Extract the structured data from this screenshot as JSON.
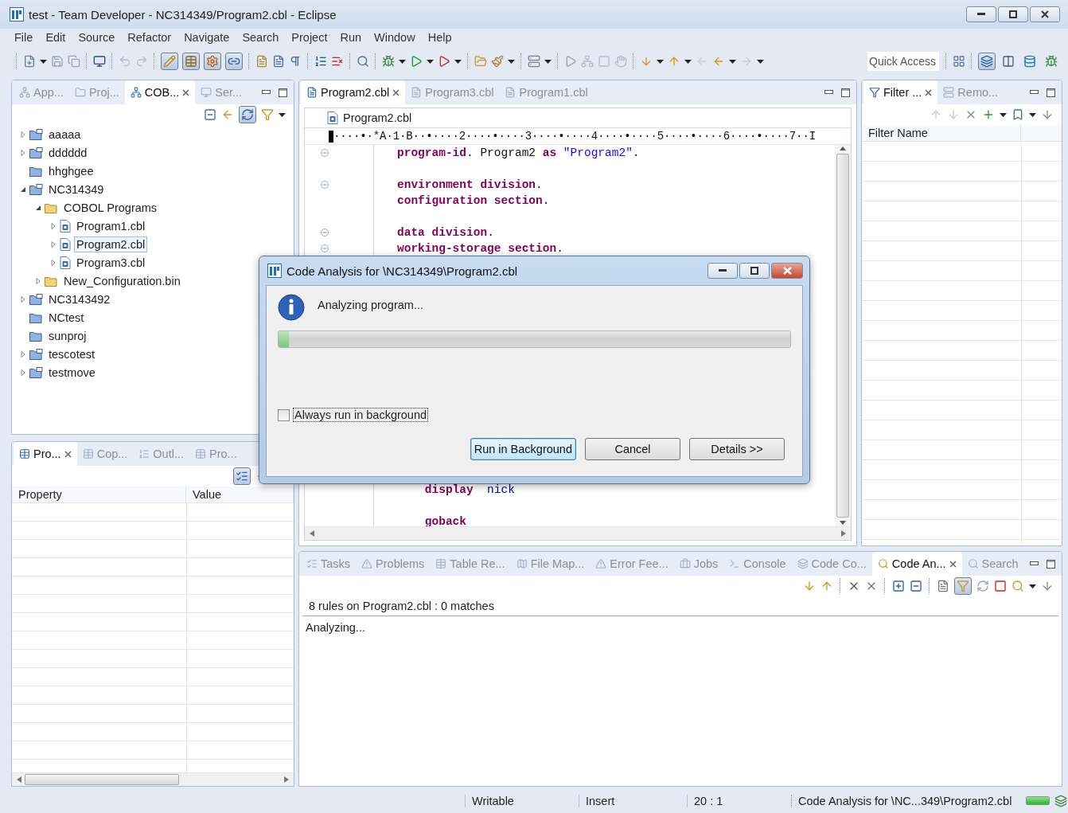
{
  "window": {
    "title": "test - Team Developer - NC314349/Program2.cbl - Eclipse"
  },
  "menu": [
    "File",
    "Edit",
    "Source",
    "Refactor",
    "Navigate",
    "Search",
    "Project",
    "Run",
    "Window",
    "Help"
  ],
  "toolbar": {
    "toggles": [
      {
        "pressed": true
      },
      {
        "pressed": true
      },
      {
        "pressed": true
      },
      {
        "pressed": true
      }
    ],
    "quick_access": {
      "placeholder": "Quick Access"
    },
    "perspectives": [
      {
        "selected": true
      },
      {
        "selected": false
      },
      {
        "selected": false
      },
      {
        "selected": false
      }
    ]
  },
  "explorer": {
    "tabs": [
      {
        "label": "App...",
        "selected": false
      },
      {
        "label": "Proj...",
        "selected": false
      },
      {
        "label": "COB...",
        "selected": true
      },
      {
        "label": "Ser...",
        "selected": false
      }
    ],
    "link_toggle": {
      "pressed": true
    },
    "tree": [
      {
        "label": "aaaaa",
        "kind": "project",
        "expanded": false,
        "selected": false
      },
      {
        "label": "dddddd",
        "kind": "project",
        "expanded": false,
        "selected": false
      },
      {
        "label": "hhghgee",
        "kind": "closed-project",
        "selected": false
      },
      {
        "label": "NC314349",
        "kind": "project",
        "expanded": true,
        "selected": false,
        "children": [
          {
            "label": "COBOL Programs",
            "kind": "folder",
            "expanded": true,
            "selected": false,
            "children": [
              {
                "label": "Program1.cbl",
                "kind": "file",
                "expanded": false,
                "selected": false
              },
              {
                "label": "Program2.cbl",
                "kind": "file",
                "expanded": false,
                "selected": true
              },
              {
                "label": "Program3.cbl",
                "kind": "file",
                "expanded": false,
                "selected": false
              }
            ]
          },
          {
            "label": "New_Configuration.bin",
            "kind": "folder",
            "expanded": false,
            "selected": false
          }
        ]
      },
      {
        "label": "NC3143492",
        "kind": "project",
        "expanded": false,
        "selected": false
      },
      {
        "label": "NCtest",
        "kind": "closed-project",
        "selected": false
      },
      {
        "label": "sunproj",
        "kind": "closed-project",
        "selected": false
      },
      {
        "label": "tescotest",
        "kind": "project",
        "expanded": false,
        "selected": false
      },
      {
        "label": "testmove",
        "kind": "project",
        "expanded": false,
        "selected": false
      }
    ]
  },
  "properties": {
    "tabs": [
      {
        "label": "Pro...",
        "selected": true
      },
      {
        "label": "Cop...",
        "selected": false
      },
      {
        "label": "Outl...",
        "selected": false
      },
      {
        "label": "Pro...",
        "selected": false
      }
    ],
    "categories_toggle": {
      "pressed": true
    },
    "columns": [
      "Property",
      "Value"
    ]
  },
  "editor": {
    "tabs": [
      {
        "label": "Program2.cbl",
        "selected": true
      },
      {
        "label": "Program3.cbl",
        "selected": false
      },
      {
        "label": "Program1.cbl",
        "selected": false
      }
    ],
    "breadcrumb": "Program2.cbl",
    "ruler": "····•·*A·1·B··•····2····•····3····•····4····•····5····•····6····•····7··I",
    "lines_top": [
      {
        "fold": true,
        "tokens": [
          {
            "kind": "keyword",
            "text": "program-id"
          },
          {
            "kind": "plain",
            "text": ". Program2 "
          },
          {
            "kind": "keyword",
            "text": "as"
          },
          {
            "kind": "string",
            "text": " \"Program2\""
          },
          {
            "kind": "plain",
            "text": "."
          }
        ]
      },
      {
        "blank": true
      },
      {
        "fold": true,
        "tokens": [
          {
            "kind": "keyword",
            "text": "environment division"
          },
          {
            "kind": "plain",
            "text": "."
          }
        ]
      },
      {
        "fold": false,
        "tokens": [
          {
            "kind": "keyword",
            "text": "configuration section"
          },
          {
            "kind": "plain",
            "text": "."
          }
        ]
      },
      {
        "blank": true
      },
      {
        "fold": true,
        "tokens": [
          {
            "kind": "keyword",
            "text": "data division"
          },
          {
            "kind": "plain",
            "text": "."
          }
        ]
      },
      {
        "fold": true,
        "tokens": [
          {
            "kind": "keyword",
            "text": "working-storage section"
          },
          {
            "kind": "plain",
            "text": "."
          }
        ]
      }
    ],
    "lines_bottom": [
      {
        "fold": false,
        "tokens": [
          {
            "kind": "keyword",
            "text": "    display"
          },
          {
            "kind": "identifier",
            "text": "  nick"
          }
        ]
      },
      {
        "blank": true
      },
      {
        "fold": false,
        "tokens": [
          {
            "kind": "keyword",
            "text": "    goback"
          }
        ]
      }
    ]
  },
  "filters": {
    "tabs": [
      {
        "label": "Filter ...",
        "selected": true
      },
      {
        "label": "Remo...",
        "selected": false
      }
    ],
    "columns": [
      "Filter Name"
    ]
  },
  "results": {
    "tabs": [
      {
        "label": "Tasks",
        "selected": false
      },
      {
        "label": "Problems",
        "selected": false
      },
      {
        "label": "Table Re...",
        "selected": false
      },
      {
        "label": "File Map...",
        "selected": false
      },
      {
        "label": "Error Fee...",
        "selected": false
      },
      {
        "label": "Jobs",
        "selected": false
      },
      {
        "label": "Console",
        "selected": false
      },
      {
        "label": "Code Co...",
        "selected": false
      },
      {
        "label": "Code An...",
        "selected": true
      },
      {
        "label": "Search",
        "selected": false
      }
    ],
    "filter_toggle": {
      "pressed": true
    },
    "summary": "8 rules on Program2.cbl : 0 matches",
    "message": "Analyzing..."
  },
  "status_bar": {
    "fields": [
      "Writable",
      "Insert",
      "20 : 1"
    ],
    "job": "Code Analysis for \\NC...349\\Program2.cbl",
    "level": 1
  },
  "dialog": {
    "title": "Code Analysis for \\NC314349\\Program2.cbl",
    "message": "Analyzing program...",
    "progress": {
      "level": 0.02
    },
    "checkbox": {
      "label": "Always run in background",
      "checked": false
    },
    "buttons": [
      {
        "label": "Run in Background",
        "default": true
      },
      {
        "label": "Cancel",
        "default": false
      },
      {
        "label": "Details >>",
        "default": false
      }
    ]
  }
}
